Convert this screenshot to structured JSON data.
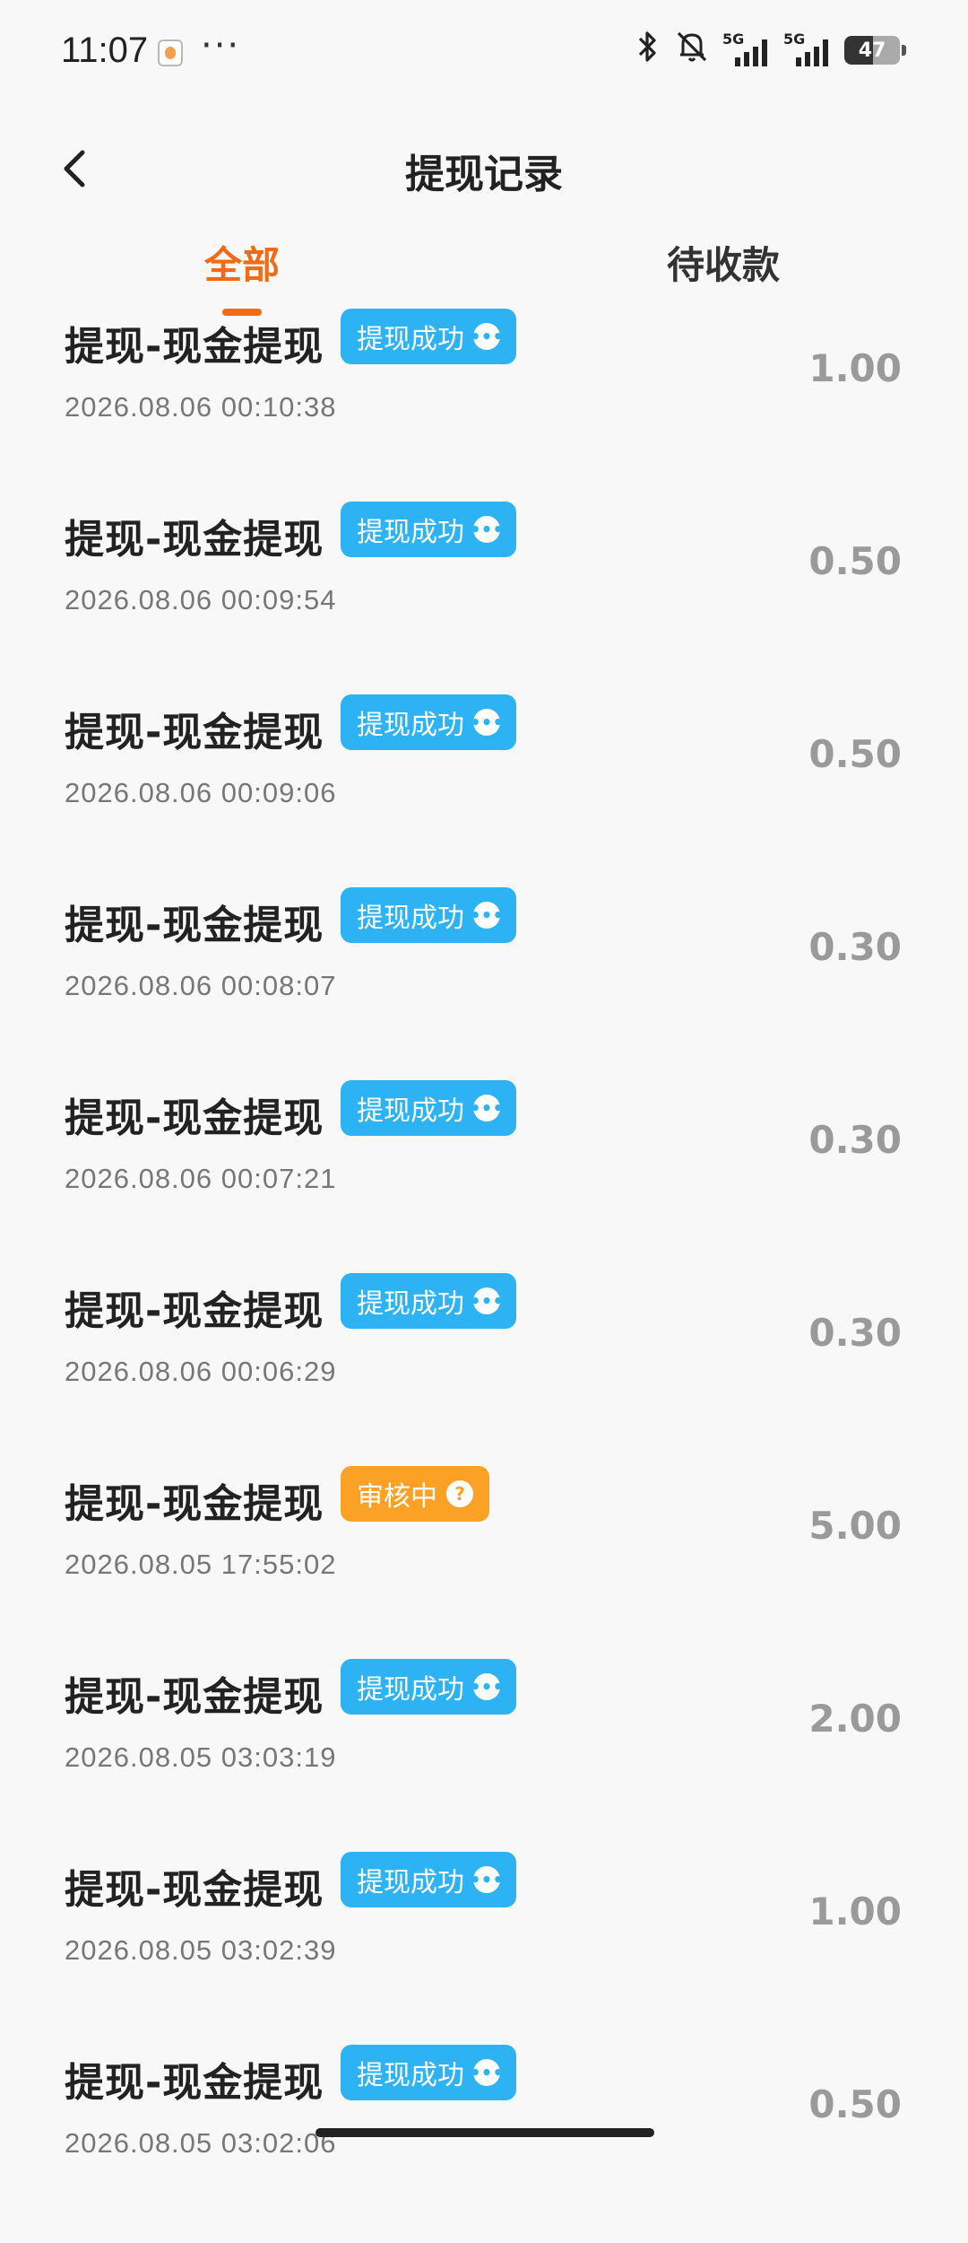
{
  "status_bar": {
    "time": "11:07",
    "more": "···",
    "network_label_1": "5G",
    "network_label_2": "5G",
    "battery": "47",
    "icons": [
      "app-icon",
      "bluetooth-icon",
      "mute-icon",
      "signal-icon",
      "battery-icon"
    ]
  },
  "header": {
    "title": "提现记录"
  },
  "tabs": [
    {
      "label": "全部",
      "active": true
    },
    {
      "label": "待收款",
      "active": false
    }
  ],
  "records": [
    {
      "title": "提现-现金提现",
      "status": "提现成功",
      "status_type": "success",
      "time": "2026.08.06 00:10:38",
      "amount": "1.00"
    },
    {
      "title": "提现-现金提现",
      "status": "提现成功",
      "status_type": "success",
      "time": "2026.08.06 00:09:54",
      "amount": "0.50"
    },
    {
      "title": "提现-现金提现",
      "status": "提现成功",
      "status_type": "success",
      "time": "2026.08.06 00:09:06",
      "amount": "0.50"
    },
    {
      "title": "提现-现金提现",
      "status": "提现成功",
      "status_type": "success",
      "time": "2026.08.06 00:08:07",
      "amount": "0.30"
    },
    {
      "title": "提现-现金提现",
      "status": "提现成功",
      "status_type": "success",
      "time": "2026.08.06 00:07:21",
      "amount": "0.30"
    },
    {
      "title": "提现-现金提现",
      "status": "提现成功",
      "status_type": "success",
      "time": "2026.08.06 00:06:29",
      "amount": "0.30"
    },
    {
      "title": "提现-现金提现",
      "status": "审核中",
      "status_type": "pending",
      "time": "2026.08.05 17:55:02",
      "amount": "5.00"
    },
    {
      "title": "提现-现金提现",
      "status": "提现成功",
      "status_type": "success",
      "time": "2026.08.05 03:03:19",
      "amount": "2.00"
    },
    {
      "title": "提现-现金提现",
      "status": "提现成功",
      "status_type": "success",
      "time": "2026.08.05 03:02:39",
      "amount": "1.00"
    },
    {
      "title": "提现-现金提现",
      "status": "提现成功",
      "status_type": "success",
      "time": "2026.08.05 03:02:06",
      "amount": "0.50"
    }
  ],
  "colors": {
    "accent": "#f16a16",
    "success_badge": "#2db2f4",
    "pending_badge": "#fba126",
    "amount_text": "#9a9a9a"
  }
}
